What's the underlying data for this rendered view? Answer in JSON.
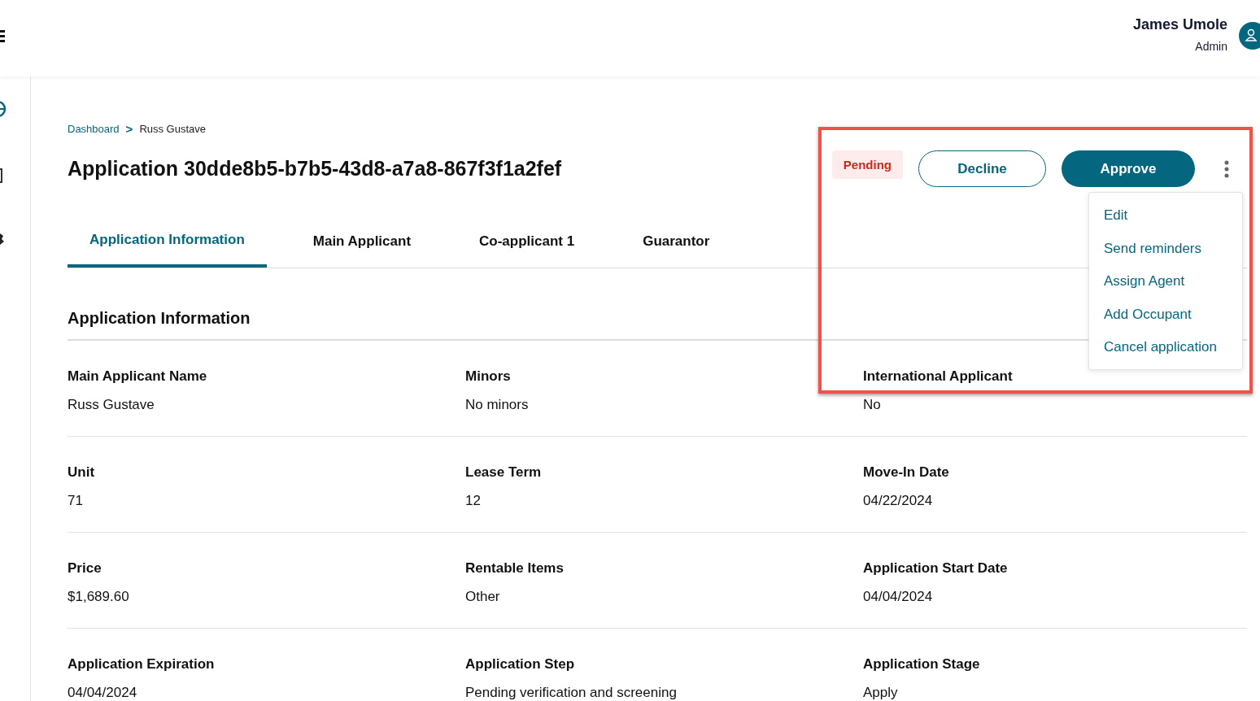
{
  "header": {
    "user_name": "James Umole",
    "user_role": "Admin"
  },
  "breadcrumb": [
    {
      "label": "Dashboard",
      "kind": "link"
    },
    {
      "label": ">",
      "kind": "separator"
    },
    {
      "label": "Russ Gustave",
      "kind": "current"
    }
  ],
  "title": "Application 30dde8b5-b7b5-43d8-a7a8-867f3f1a2fef",
  "status_badge": "Pending",
  "actions": [
    {
      "label": "Decline",
      "kind": "outline"
    },
    {
      "label": "Approve",
      "kind": "primary"
    }
  ],
  "menu_items": [
    "Edit",
    "Send reminders",
    "Assign Agent",
    "Add Occupant",
    "Cancel application"
  ],
  "tabs": [
    {
      "label": "Application Information",
      "selected": true
    },
    {
      "label": "Main Applicant",
      "selected": false
    },
    {
      "label": "Co-applicant 1",
      "selected": false
    },
    {
      "label": "Guarantor",
      "selected": false
    }
  ],
  "section_title": "Application Information",
  "field_rows": [
    [
      {
        "label": "Main Applicant Name",
        "value": "Russ Gustave"
      },
      {
        "label": "Minors",
        "value": "No minors"
      },
      {
        "label": "International Applicant",
        "value": "No"
      }
    ],
    [
      {
        "label": "Unit",
        "value": "71"
      },
      {
        "label": "Lease Term",
        "value": "12"
      },
      {
        "label": "Move-In Date",
        "value": "04/22/2024"
      }
    ],
    [
      {
        "label": "Price",
        "value": "$1,689.60"
      },
      {
        "label": "Rentable Items",
        "value": "Other"
      },
      {
        "label": "Application Start Date",
        "value": "04/04/2024"
      }
    ],
    [
      {
        "label": "Application Expiration",
        "value": "04/04/2024"
      },
      {
        "label": "Application Step",
        "value": "Pending verification and screening"
      },
      {
        "label": "Application Stage",
        "value": "Apply"
      }
    ]
  ]
}
